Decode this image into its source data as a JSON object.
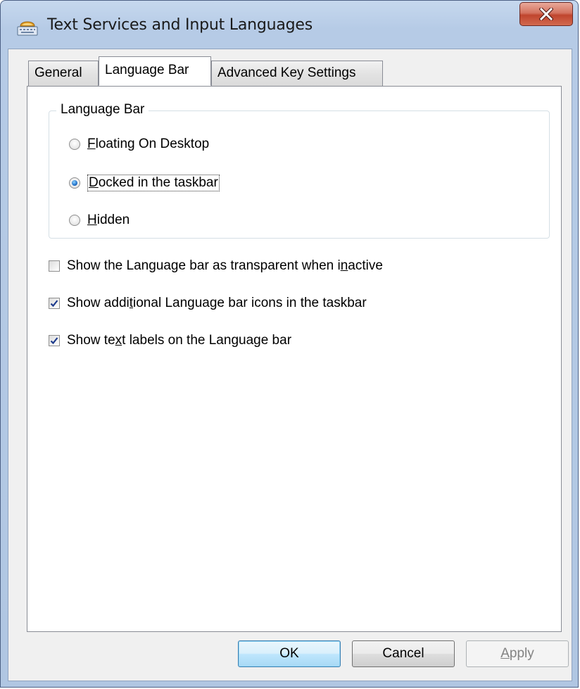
{
  "window": {
    "title": "Text Services and Input Languages",
    "close_label": "X"
  },
  "tabs": [
    {
      "label": "General",
      "active": false
    },
    {
      "label": "Language Bar",
      "active": true
    },
    {
      "label": "Advanced Key Settings",
      "active": false
    }
  ],
  "language_bar_group": {
    "legend": "Language Bar",
    "options": [
      {
        "mnemonic": "F",
        "rest": "loating On Desktop",
        "selected": false
      },
      {
        "mnemonic": "D",
        "rest": "ocked in the taskbar",
        "selected": true
      },
      {
        "mnemonic": "H",
        "rest": "idden",
        "selected": false
      }
    ]
  },
  "checkboxes": [
    {
      "before": "Show the Language bar as transparent when i",
      "mnemonic": "n",
      "after": "active",
      "checked": false
    },
    {
      "before": "Show addi",
      "mnemonic": "t",
      "after": "ional Language bar icons in the taskbar",
      "checked": true
    },
    {
      "before": "Show te",
      "mnemonic": "x",
      "after": "t labels on the Language bar",
      "checked": true
    }
  ],
  "buttons": {
    "ok": "OK",
    "cancel": "Cancel",
    "apply_mnemonic": "A",
    "apply_rest": "pply"
  },
  "colors": {
    "titlebar": "#b6cbe6",
    "close_button": "#c0452e",
    "default_button_border": "#3c7fb1",
    "radio_dot": "#1f6fc8",
    "checkmark": "#1c3a8c"
  }
}
